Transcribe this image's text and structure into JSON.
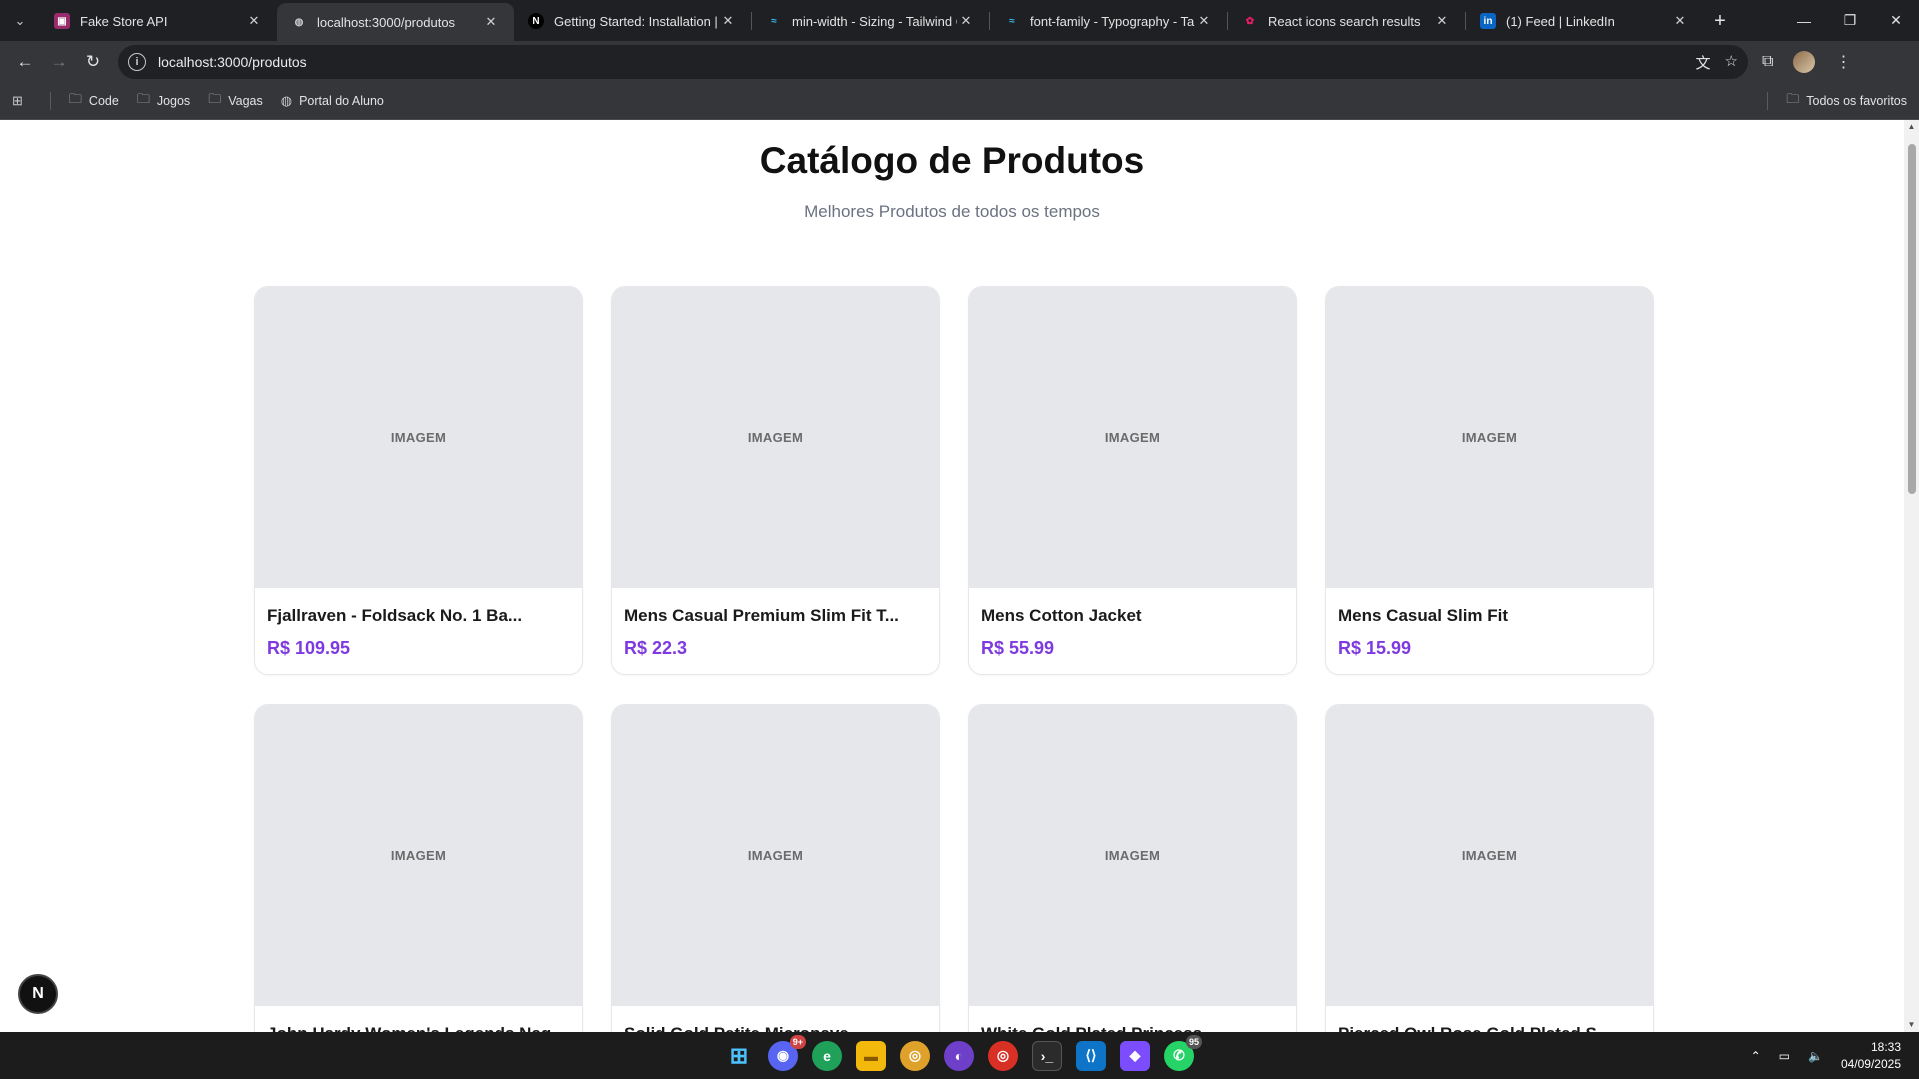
{
  "browser": {
    "tabs": [
      {
        "title": "Fake Store API",
        "favicon": "fakestore-icon",
        "color": "#9b2c6b",
        "active": false
      },
      {
        "title": "localhost:3000/produtos",
        "favicon": "globe-icon",
        "color": "#5f6368",
        "active": true
      },
      {
        "title": "Getting Started: Installation | N",
        "favicon": "nextjs-icon",
        "color": "#000000",
        "active": false
      },
      {
        "title": "min-width - Sizing - Tailwind C",
        "favicon": "tailwind-icon",
        "color": "#38bdf8",
        "active": false
      },
      {
        "title": "font-family - Typography - Tailw",
        "favicon": "tailwind-icon",
        "color": "#38bdf8",
        "active": false
      },
      {
        "title": "React icons search results",
        "favicon": "react-icons-icon",
        "color": "#e91e63",
        "active": false
      },
      {
        "title": "(1) Feed | LinkedIn",
        "favicon": "linkedin-icon",
        "color": "#0a66c2",
        "active": false
      }
    ],
    "address": "localhost:3000/produtos",
    "bookmarks": [
      {
        "label": "Code",
        "icon": "folder-icon"
      },
      {
        "label": "Jogos",
        "icon": "folder-icon"
      },
      {
        "label": "Vagas",
        "icon": "folder-icon"
      },
      {
        "label": "Portal do Aluno",
        "icon": "globe-icon"
      }
    ],
    "all_bookmarks_label": "Todos os favoritos"
  },
  "page": {
    "title": "Catálogo de Produtos",
    "subtitle": "Melhores Produtos de todos os tempos",
    "image_placeholder": "IMAGEM",
    "products": [
      {
        "name": "Fjallraven - Foldsack No. 1 Ba...",
        "price": "R$ 109.95"
      },
      {
        "name": "Mens Casual Premium Slim Fit T...",
        "price": "R$ 22.3"
      },
      {
        "name": "Mens Cotton Jacket",
        "price": "R$ 55.99"
      },
      {
        "name": "Mens Casual Slim Fit",
        "price": "R$ 15.99"
      },
      {
        "name": "John Hardy Women's Legends Nag...",
        "price": ""
      },
      {
        "name": "Solid Gold Petite Micropave ...",
        "price": ""
      },
      {
        "name": "White Gold Plated Princess",
        "price": ""
      },
      {
        "name": "Pierced Owl Rose Gold Plated S...",
        "price": ""
      }
    ],
    "next_badge": "N"
  },
  "taskbar": {
    "time": "18:33",
    "date": "04/09/2025",
    "discord_badge": "9+",
    "whatsapp_badge": "95"
  },
  "colors": {
    "price": "#7e3ae0",
    "image_bg": "#e5e7eb"
  }
}
